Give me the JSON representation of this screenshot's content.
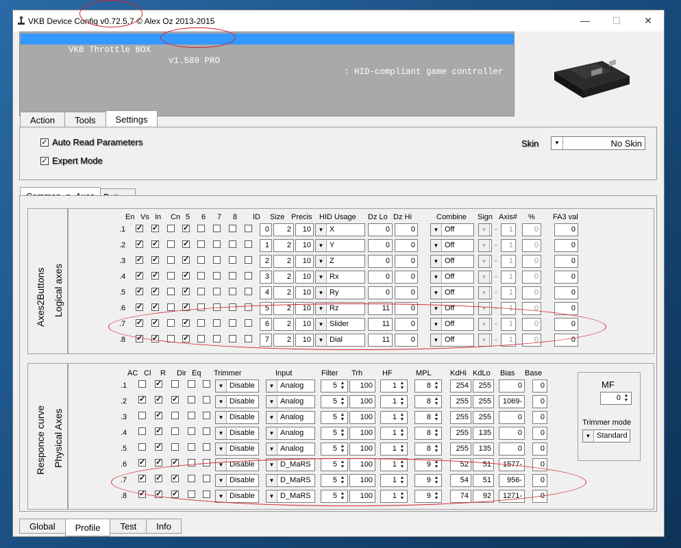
{
  "window": {
    "title": "VKB Device Config v0.72.5.7 © Alex Oz 2013-2015",
    "minimize": "—",
    "maximize": "☐",
    "close": "✕"
  },
  "device": {
    "name": "VKB Throttle BOX",
    "version": "v1.589 PRO",
    "type": ": HID-compliant game controller"
  },
  "top_tabs": [
    "Action",
    "Tools",
    "Settings"
  ],
  "settings": {
    "auto_read": "Auto Read Parameters",
    "expert_mode": "Expert Mode",
    "skin_label": "Skin",
    "skin_value": "No Skin"
  },
  "inner_tabs": [
    "Common -n- Axes",
    "Buttons"
  ],
  "logical": {
    "group_title": "Axes2Buttons",
    "group_subtitle": "Logical axes",
    "headers": [
      "En",
      "Vs",
      "In",
      "Cn",
      "5",
      "6",
      "7",
      "8",
      "ID",
      "Size",
      "Precis",
      "HID Usage",
      "Dz Lo",
      "Dz Hi",
      "Combine",
      "Sign",
      "Axis#",
      "%",
      "FA3 val"
    ],
    "rows": [
      {
        "idx": ".1",
        "checks": [
          1,
          1,
          0,
          1,
          0,
          0,
          0,
          0
        ],
        "id": "0",
        "size": "2",
        "precis": "10",
        "usage": "X",
        "dzlo": "0",
        "dzhi": "0",
        "combine": "Off",
        "sep": "-",
        "axis": "1",
        "pct": "0",
        "fa3": "0"
      },
      {
        "idx": ".2",
        "checks": [
          1,
          1,
          0,
          1,
          0,
          0,
          0,
          0
        ],
        "id": "1",
        "size": "2",
        "precis": "10",
        "usage": "Y",
        "dzlo": "0",
        "dzhi": "0",
        "combine": "Off",
        "sep": "-",
        "axis": "1",
        "pct": "0",
        "fa3": "0"
      },
      {
        "idx": ".3",
        "checks": [
          1,
          1,
          0,
          1,
          0,
          0,
          0,
          0
        ],
        "id": "2",
        "size": "2",
        "precis": "10",
        "usage": "Z",
        "dzlo": "0",
        "dzhi": "0",
        "combine": "Off",
        "sep": "-",
        "axis": "1",
        "pct": "0",
        "fa3": "0"
      },
      {
        "idx": ".4",
        "checks": [
          1,
          1,
          0,
          1,
          0,
          0,
          0,
          0
        ],
        "id": "3",
        "size": "2",
        "precis": "10",
        "usage": "Rx",
        "dzlo": "0",
        "dzhi": "0",
        "combine": "Off",
        "sep": "-",
        "axis": "1",
        "pct": "0",
        "fa3": "0"
      },
      {
        "idx": ".5",
        "checks": [
          1,
          1,
          0,
          1,
          0,
          0,
          0,
          0
        ],
        "id": "4",
        "size": "2",
        "precis": "10",
        "usage": "Ry",
        "dzlo": "0",
        "dzhi": "0",
        "combine": "Off",
        "sep": "-",
        "axis": "1",
        "pct": "0",
        "fa3": "0"
      },
      {
        "idx": ".6",
        "checks": [
          1,
          1,
          0,
          1,
          0,
          0,
          0,
          0
        ],
        "id": "5",
        "size": "2",
        "precis": "10",
        "usage": "Rz",
        "dzlo": "11",
        "dzhi": "0",
        "combine": "Off",
        "sep": "-",
        "axis": "1",
        "pct": "0",
        "fa3": "0"
      },
      {
        "idx": ".7",
        "checks": [
          1,
          1,
          0,
          1,
          0,
          0,
          0,
          0
        ],
        "id": "6",
        "size": "2",
        "precis": "10",
        "usage": "Slider",
        "dzlo": "11",
        "dzhi": "0",
        "combine": "Off",
        "sep": "-",
        "axis": "1",
        "pct": "0",
        "fa3": "0"
      },
      {
        "idx": ".8",
        "checks": [
          1,
          1,
          0,
          1,
          0,
          0,
          0,
          0
        ],
        "id": "7",
        "size": "2",
        "precis": "10",
        "usage": "Dial",
        "dzlo": "11",
        "dzhi": "0",
        "combine": "Off",
        "sep": "-",
        "axis": "1",
        "pct": "0",
        "fa3": "0"
      }
    ]
  },
  "physical": {
    "group_title": "Responce curve",
    "group_subtitle": "Physical Axes",
    "headers": [
      "AC",
      "Cl",
      "R",
      "Dir",
      "Eq",
      "Trimmer",
      "Input",
      "Filter",
      "Trh",
      "HF",
      "MPL",
      "KdHi",
      "KdLo",
      "Bias",
      "Base"
    ],
    "rows": [
      {
        "idx": ".1",
        "checks": [
          0,
          1,
          0,
          0,
          0
        ],
        "trimmer": "Disable",
        "input": "Analog",
        "filter": "5",
        "trh": "100",
        "hf": "1",
        "mpl": "8",
        "kdhi": "254",
        "kdlo": "255",
        "bias": "0",
        "base": "0"
      },
      {
        "idx": ".2",
        "checks": [
          1,
          1,
          1,
          0,
          0
        ],
        "trimmer": "Disable",
        "input": "Analog",
        "filter": "5",
        "trh": "100",
        "hf": "1",
        "mpl": "8",
        "kdhi": "255",
        "kdlo": "255",
        "bias": "1069-",
        "base": "0"
      },
      {
        "idx": ".3",
        "checks": [
          0,
          1,
          0,
          0,
          0
        ],
        "trimmer": "Disable",
        "input": "Analog",
        "filter": "5",
        "trh": "100",
        "hf": "1",
        "mpl": "8",
        "kdhi": "255",
        "kdlo": "255",
        "bias": "0",
        "base": "0"
      },
      {
        "idx": ".4",
        "checks": [
          0,
          1,
          0,
          0,
          0
        ],
        "trimmer": "Disable",
        "input": "Analog",
        "filter": "5",
        "trh": "100",
        "hf": "1",
        "mpl": "8",
        "kdhi": "255",
        "kdlo": "135",
        "bias": "0",
        "base": "0"
      },
      {
        "idx": ".5",
        "checks": [
          0,
          1,
          0,
          0,
          0
        ],
        "trimmer": "Disable",
        "input": "Analog",
        "filter": "5",
        "trh": "100",
        "hf": "1",
        "mpl": "8",
        "kdhi": "255",
        "kdlo": "135",
        "bias": "0",
        "base": "0"
      },
      {
        "idx": ".6",
        "checks": [
          1,
          1,
          1,
          0,
          0
        ],
        "trimmer": "Disable",
        "input": "D_MaRS",
        "filter": "5",
        "trh": "100",
        "hf": "1",
        "mpl": "9",
        "kdhi": "52",
        "kdlo": "51",
        "bias": "1577-",
        "base": "0"
      },
      {
        "idx": ".7",
        "checks": [
          1,
          1,
          1,
          0,
          0
        ],
        "trimmer": "Disable",
        "input": "D_MaRS",
        "filter": "5",
        "trh": "100",
        "hf": "1",
        "mpl": "9",
        "kdhi": "54",
        "kdlo": "51",
        "bias": "956-",
        "base": "0"
      },
      {
        "idx": ".8",
        "checks": [
          1,
          1,
          1,
          0,
          0
        ],
        "trimmer": "Disable",
        "input": "D_MaRS",
        "filter": "5",
        "trh": "100",
        "hf": "1",
        "mpl": "9",
        "kdhi": "74",
        "kdlo": "92",
        "bias": "1271-",
        "base": "0"
      }
    ]
  },
  "mf": {
    "label": "MF",
    "value": "0",
    "trimmer_mode_label": "Trimmer mode",
    "trimmer_mode_value": "Standard"
  },
  "bottom_tabs": [
    "Global",
    "Profile",
    "Test",
    "Info"
  ],
  "colors": {
    "selection": "#3399ff",
    "annotation": "#d21f2b",
    "device_panel": "#a9a9a9"
  }
}
